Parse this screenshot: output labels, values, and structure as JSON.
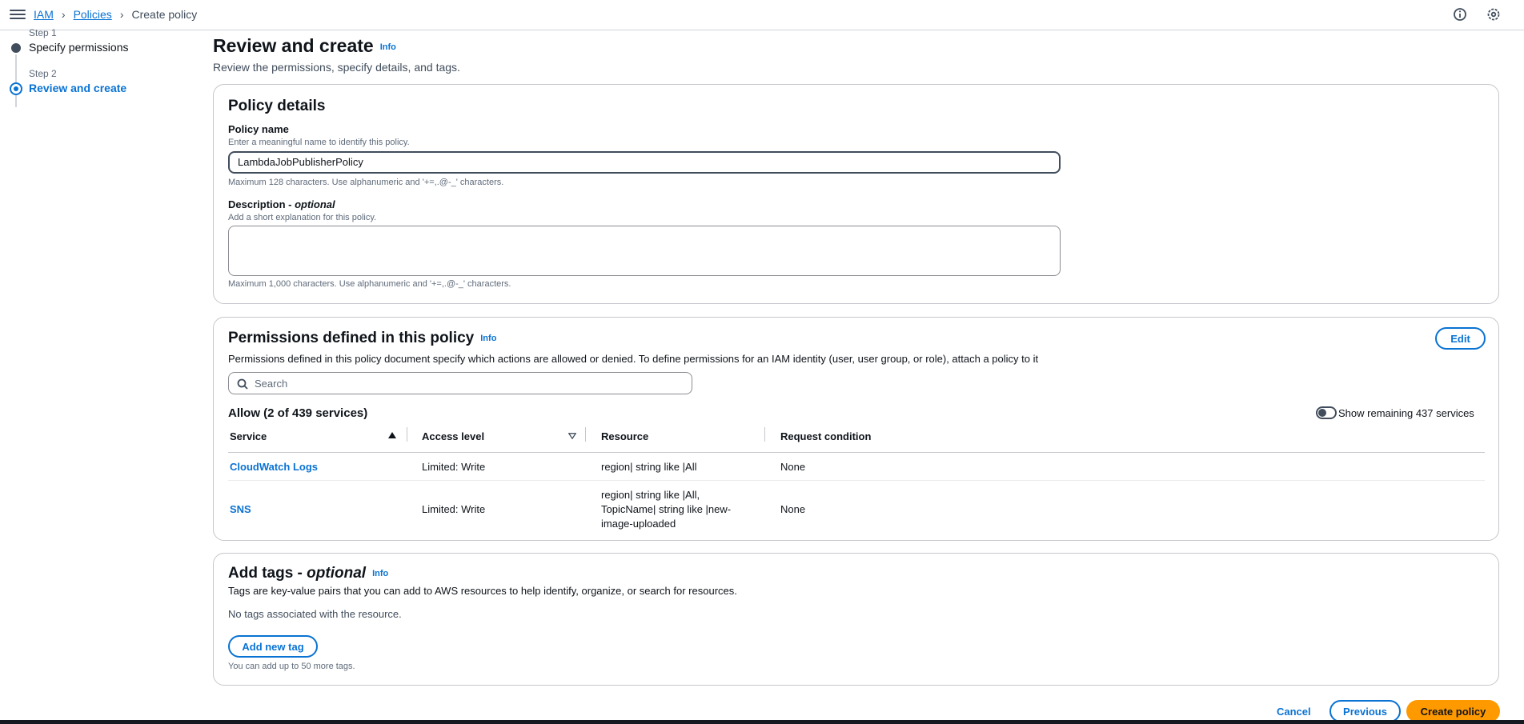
{
  "topbar": {
    "breadcrumbs": [
      "IAM",
      "Policies",
      "Create policy"
    ],
    "menu_icon": "hamburger-menu-icon",
    "right_icons": [
      "info-circle-icon",
      "settings-gear-icon"
    ]
  },
  "steps": [
    {
      "step": "Step 1",
      "label": "Specify permissions"
    },
    {
      "step": "Step 2",
      "label": "Review and create"
    }
  ],
  "page": {
    "title": "Review and create",
    "info": "Info",
    "subtitle": "Review the permissions, specify details, and tags."
  },
  "policy_details": {
    "title": "Policy details",
    "name_label": "Policy name",
    "name_desc": "Enter a meaningful name to identify this policy.",
    "name_value": "LambdaJobPublisherPolicy",
    "name_constraint": "Maximum 128 characters. Use alphanumeric and '+=,.@-_' characters.",
    "desc_label": "Description - ",
    "desc_optional": "optional",
    "desc_desc": "Add a short explanation for this policy.",
    "desc_value": "",
    "desc_constraint": "Maximum 1,000 characters. Use alphanumeric and '+=,.@-_' characters."
  },
  "permissions": {
    "title": "Permissions defined in this policy",
    "info": "Info",
    "edit": "Edit",
    "description": "Permissions defined in this policy document specify which actions are allowed or denied. To define permissions for an IAM identity (user, user group, or role), attach a policy to it",
    "search_placeholder": "Search",
    "allow_heading": "Allow (2 of 439 services)",
    "toggle_label": "Show remaining 437 services",
    "columns": [
      "Service",
      "Access level",
      "Resource",
      "Request condition"
    ],
    "rows": [
      {
        "service": "CloudWatch Logs",
        "access": "Limited: Write",
        "resource": "region| string like |All",
        "condition": "None"
      },
      {
        "service": "SNS",
        "access": "Limited: Write",
        "resource": "region| string like |All, TopicName| string like |new-image-uploaded",
        "condition": "None"
      }
    ]
  },
  "tags": {
    "title": "Add tags - ",
    "optional": "optional",
    "info": "Info",
    "description": "Tags are key-value pairs that you can add to AWS resources to help identify, organize, or search for resources.",
    "empty": "No tags associated with the resource.",
    "add_button": "Add new tag",
    "limit": "You can add up to 50 more tags."
  },
  "footer": {
    "cancel": "Cancel",
    "previous": "Previous",
    "create": "Create policy"
  }
}
